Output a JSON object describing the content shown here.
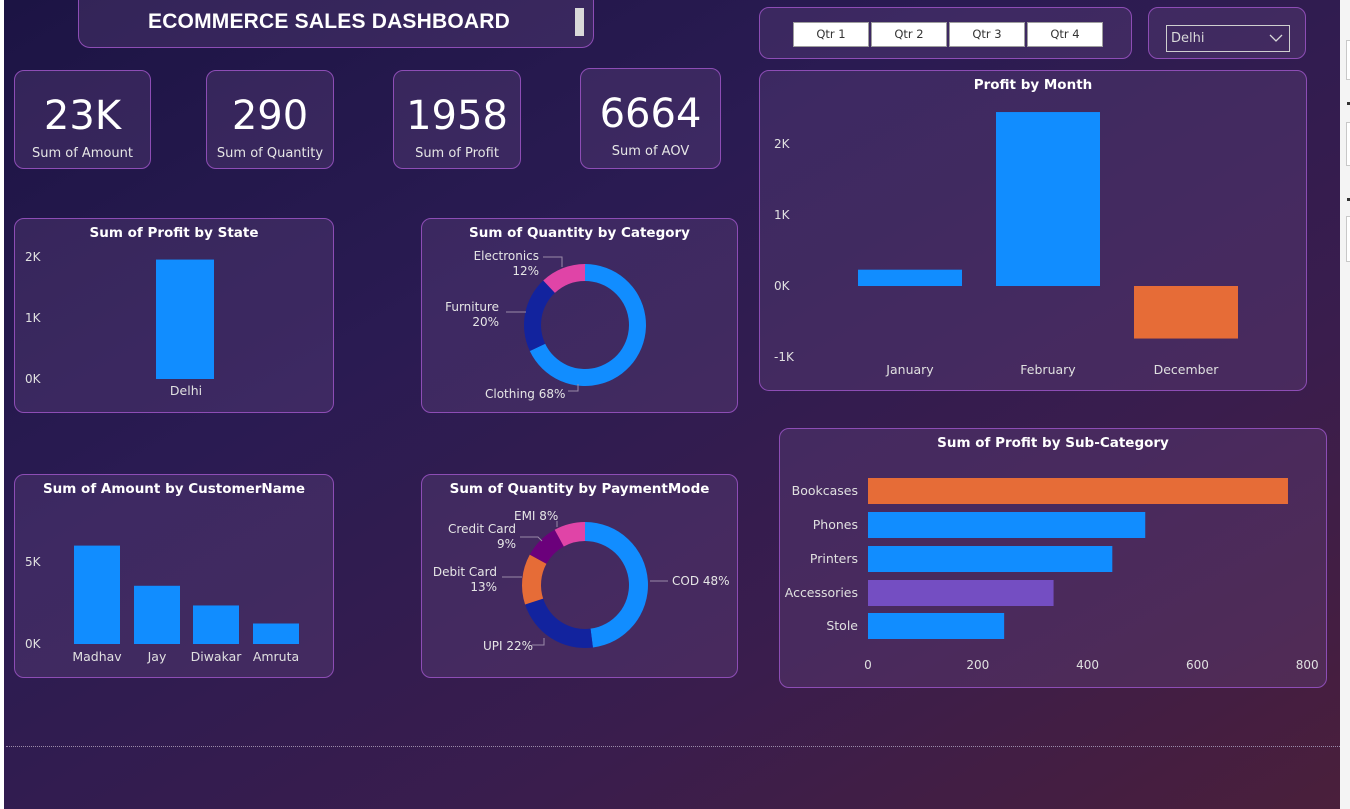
{
  "title": "ECOMMERCE SALES DASHBOARD",
  "kpis": [
    {
      "value": "23K",
      "label": "Sum of Amount"
    },
    {
      "value": "290",
      "label": "Sum of Quantity"
    },
    {
      "value": "1958",
      "label": "Sum of Profit"
    },
    {
      "value": "6664",
      "label": "Sum of AOV"
    }
  ],
  "quarter_slicer": [
    "Qtr 1",
    "Qtr 2",
    "Qtr 3",
    "Qtr 4"
  ],
  "state_dropdown": {
    "selected": "Delhi",
    "icon": "chevron-down-icon"
  },
  "colors": {
    "blue": "#118dff",
    "dark_blue": "#12239e",
    "orange": "#e66c37",
    "magenta": "#e044a7",
    "purple": "#744ec2",
    "dark_purple": "#6b007b"
  },
  "chart_data": [
    {
      "id": "profit_by_month",
      "type": "bar",
      "title": "Profit by Month",
      "categories": [
        "January",
        "February",
        "December"
      ],
      "values": [
        230,
        2450,
        -740
      ],
      "yticks": [
        "2K",
        "1K",
        "0K",
        "-1K"
      ],
      "ytick_values": [
        2000,
        1000,
        0,
        -1000
      ],
      "ylim": [
        -1000,
        2450
      ]
    },
    {
      "id": "profit_by_state",
      "type": "bar",
      "title": "Sum of Profit by State",
      "categories": [
        "Delhi"
      ],
      "values": [
        1958
      ],
      "yticks": [
        "2K",
        "1K",
        "0K"
      ],
      "ytick_values": [
        2000,
        1000,
        0
      ],
      "ylim": [
        0,
        2000
      ]
    },
    {
      "id": "quantity_by_category",
      "type": "pie",
      "title": "Sum of Quantity by Category",
      "slices": [
        {
          "label": "Clothing",
          "percent": 68,
          "text": "Clothing 68%"
        },
        {
          "label": "Furniture",
          "percent": 20,
          "text": "Furniture 20%"
        },
        {
          "label": "Electronics",
          "percent": 12,
          "text": "Electronics 12%"
        }
      ]
    },
    {
      "id": "amount_by_customer",
      "type": "bar",
      "title": "Sum of Amount by CustomerName",
      "categories": [
        "Madhav",
        "Jay",
        "Diwakar",
        "Amruta"
      ],
      "values": [
        6000,
        3550,
        2350,
        1250
      ],
      "yticks": [
        "5K",
        "0K"
      ],
      "ytick_values": [
        5000,
        0
      ],
      "ylim": [
        0,
        6000
      ]
    },
    {
      "id": "quantity_by_paymentmode",
      "type": "pie",
      "title": "Sum of Quantity by PaymentMode",
      "slices": [
        {
          "label": "COD",
          "percent": 48,
          "text": "COD 48%"
        },
        {
          "label": "UPI",
          "percent": 22,
          "text": "UPI 22%"
        },
        {
          "label": "Debit Card",
          "percent": 13,
          "text": "Debit Card 13%"
        },
        {
          "label": "Credit Card",
          "percent": 9,
          "text": "Credit Card 9%"
        },
        {
          "label": "EMI",
          "percent": 8,
          "text": "EMI 8%"
        }
      ]
    },
    {
      "id": "profit_by_subcategory",
      "type": "bar",
      "title": "Sum of Profit by Sub-Category",
      "orientation": "horizontal",
      "categories": [
        "Bookcases",
        "Phones",
        "Printers",
        "Accessories",
        "Stole"
      ],
      "values": [
        765,
        505,
        445,
        338,
        248
      ],
      "xticks": [
        "0",
        "200",
        "400",
        "600",
        "800"
      ],
      "xtick_values": [
        0,
        200,
        400,
        600,
        800
      ],
      "xlim": [
        0,
        800
      ]
    }
  ]
}
